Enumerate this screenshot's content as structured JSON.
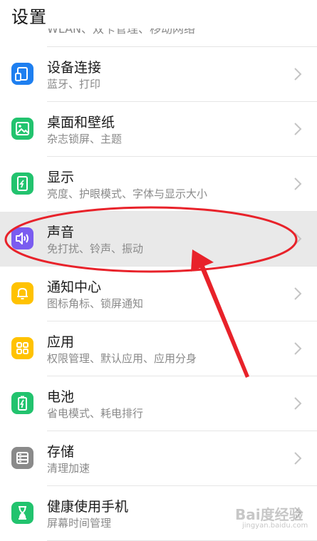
{
  "header": {
    "title": "设置"
  },
  "partial_row": {
    "subtitle": "WLAN、双卡管理、移动网络"
  },
  "items": [
    {
      "title": "设备连接",
      "subtitle": "蓝牙、打印",
      "icon": "device-connection-icon",
      "color": "#1E7FF0"
    },
    {
      "title": "桌面和壁纸",
      "subtitle": "杂志锁屏、主题",
      "icon": "wallpaper-icon",
      "color": "#22C36E"
    },
    {
      "title": "显示",
      "subtitle": "亮度、护眼模式、字体与显示大小",
      "icon": "display-icon",
      "color": "#22C36E"
    },
    {
      "title": "声音",
      "subtitle": "免打扰、铃声、振动",
      "icon": "sound-icon",
      "color": "#7A5CF0"
    },
    {
      "title": "通知中心",
      "subtitle": "图标角标、锁屏通知",
      "icon": "bell-icon",
      "color": "#FFC200"
    },
    {
      "title": "应用",
      "subtitle": "权限管理、默认应用、应用分身",
      "icon": "apps-icon",
      "color": "#FFC200"
    },
    {
      "title": "电池",
      "subtitle": "省电模式、耗电排行",
      "icon": "battery-icon",
      "color": "#22C36E"
    },
    {
      "title": "存储",
      "subtitle": "清理加速",
      "icon": "storage-icon",
      "color": "#8A8A8A"
    },
    {
      "title": "健康使用手机",
      "subtitle": "屏幕时间管理",
      "icon": "hourglass-icon",
      "color": "#22C36E"
    }
  ],
  "annotation": {
    "color": "#E8222A"
  },
  "watermark": {
    "text": "Bai度经验",
    "sub": "jingyan.baidu.com"
  }
}
